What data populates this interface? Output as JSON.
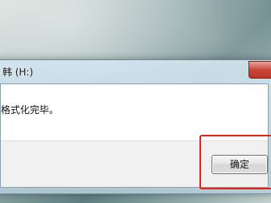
{
  "dialog": {
    "title": "韩 (H:)",
    "message": "格式化完毕。",
    "ok_label": "确定"
  },
  "colors": {
    "highlight": "#e0231c"
  }
}
